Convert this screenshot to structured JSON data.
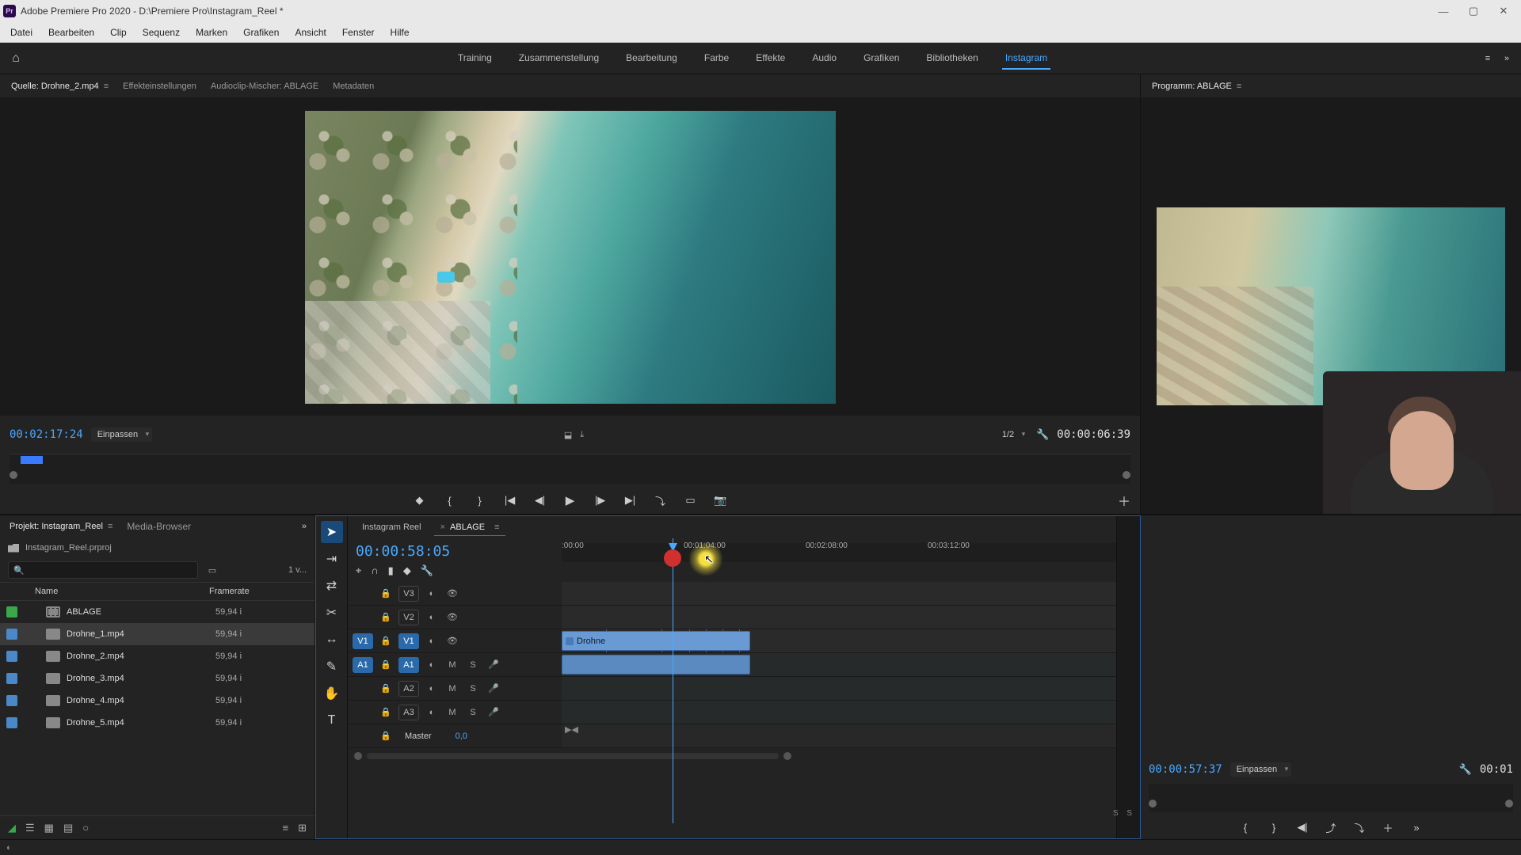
{
  "window": {
    "app_abbrev": "Pr",
    "title": "Adobe Premiere Pro 2020 - D:\\Premiere Pro\\Instagram_Reel *"
  },
  "menu": [
    "Datei",
    "Bearbeiten",
    "Clip",
    "Sequenz",
    "Marken",
    "Grafiken",
    "Ansicht",
    "Fenster",
    "Hilfe"
  ],
  "workspaces": {
    "items": [
      "Training",
      "Zusammenstellung",
      "Bearbeitung",
      "Farbe",
      "Effekte",
      "Audio",
      "Grafiken",
      "Bibliotheken",
      "Instagram"
    ],
    "active": "Instagram"
  },
  "source_panel": {
    "tabs": [
      "Quelle: Drohne_2.mp4",
      "Effekteinstellungen",
      "Audioclip-Mischer: ABLAGE",
      "Metadaten"
    ],
    "active_tab": 0,
    "timecode": "00:02:17:24",
    "zoom": "Einpassen",
    "fraction": "1/2",
    "duration": "00:00:06:39"
  },
  "program_panel": {
    "title": "Programm: ABLAGE",
    "timecode": "00:00:57:37",
    "zoom": "Einpassen",
    "duration": "00:01"
  },
  "project": {
    "tabs": [
      "Projekt: Instagram_Reel",
      "Media-Browser"
    ],
    "file": "Instagram_Reel.prproj",
    "item_count": "1 v...",
    "columns": {
      "name": "Name",
      "framerate": "Framerate"
    },
    "items": [
      {
        "name": "ABLAGE",
        "fr": "59,94 i",
        "type": "seq",
        "chip": "green",
        "selected": false
      },
      {
        "name": "Drohne_1.mp4",
        "fr": "59,94 i",
        "type": "clip",
        "chip": "blue",
        "selected": true
      },
      {
        "name": "Drohne_2.mp4",
        "fr": "59,94 i",
        "type": "clip",
        "chip": "blue",
        "selected": false
      },
      {
        "name": "Drohne_3.mp4",
        "fr": "59,94 i",
        "type": "clip",
        "chip": "blue",
        "selected": false
      },
      {
        "name": "Drohne_4.mp4",
        "fr": "59,94 i",
        "type": "clip",
        "chip": "blue",
        "selected": false
      },
      {
        "name": "Drohne_5.mp4",
        "fr": "59,94 i",
        "type": "clip",
        "chip": "blue",
        "selected": false
      }
    ]
  },
  "timeline": {
    "tabs": [
      {
        "label": "Instagram Reel",
        "active": false,
        "closable": false
      },
      {
        "label": "ABLAGE",
        "active": true,
        "closable": true
      }
    ],
    "playhead_tc": "00:00:58:05",
    "ruler_marks": [
      {
        "label": ":00:00",
        "pct": 0
      },
      {
        "label": "00:01:04:00",
        "pct": 22
      },
      {
        "label": "00:02:08:00",
        "pct": 44
      },
      {
        "label": "00:03:12:00",
        "pct": 66
      }
    ],
    "playhead_pct": 20,
    "click_highlight_pct": 26,
    "click_red_pct": 20,
    "tracks": {
      "video": [
        "V3",
        "V2",
        "V1"
      ],
      "audio": [
        "A1",
        "A2",
        "A3"
      ],
      "master": "Master",
      "master_val": "0,0",
      "v_target": "V1",
      "a_target": "A1",
      "mute": "M",
      "solo": "S"
    },
    "clip_label": "Drohne",
    "ss": "S  S"
  }
}
